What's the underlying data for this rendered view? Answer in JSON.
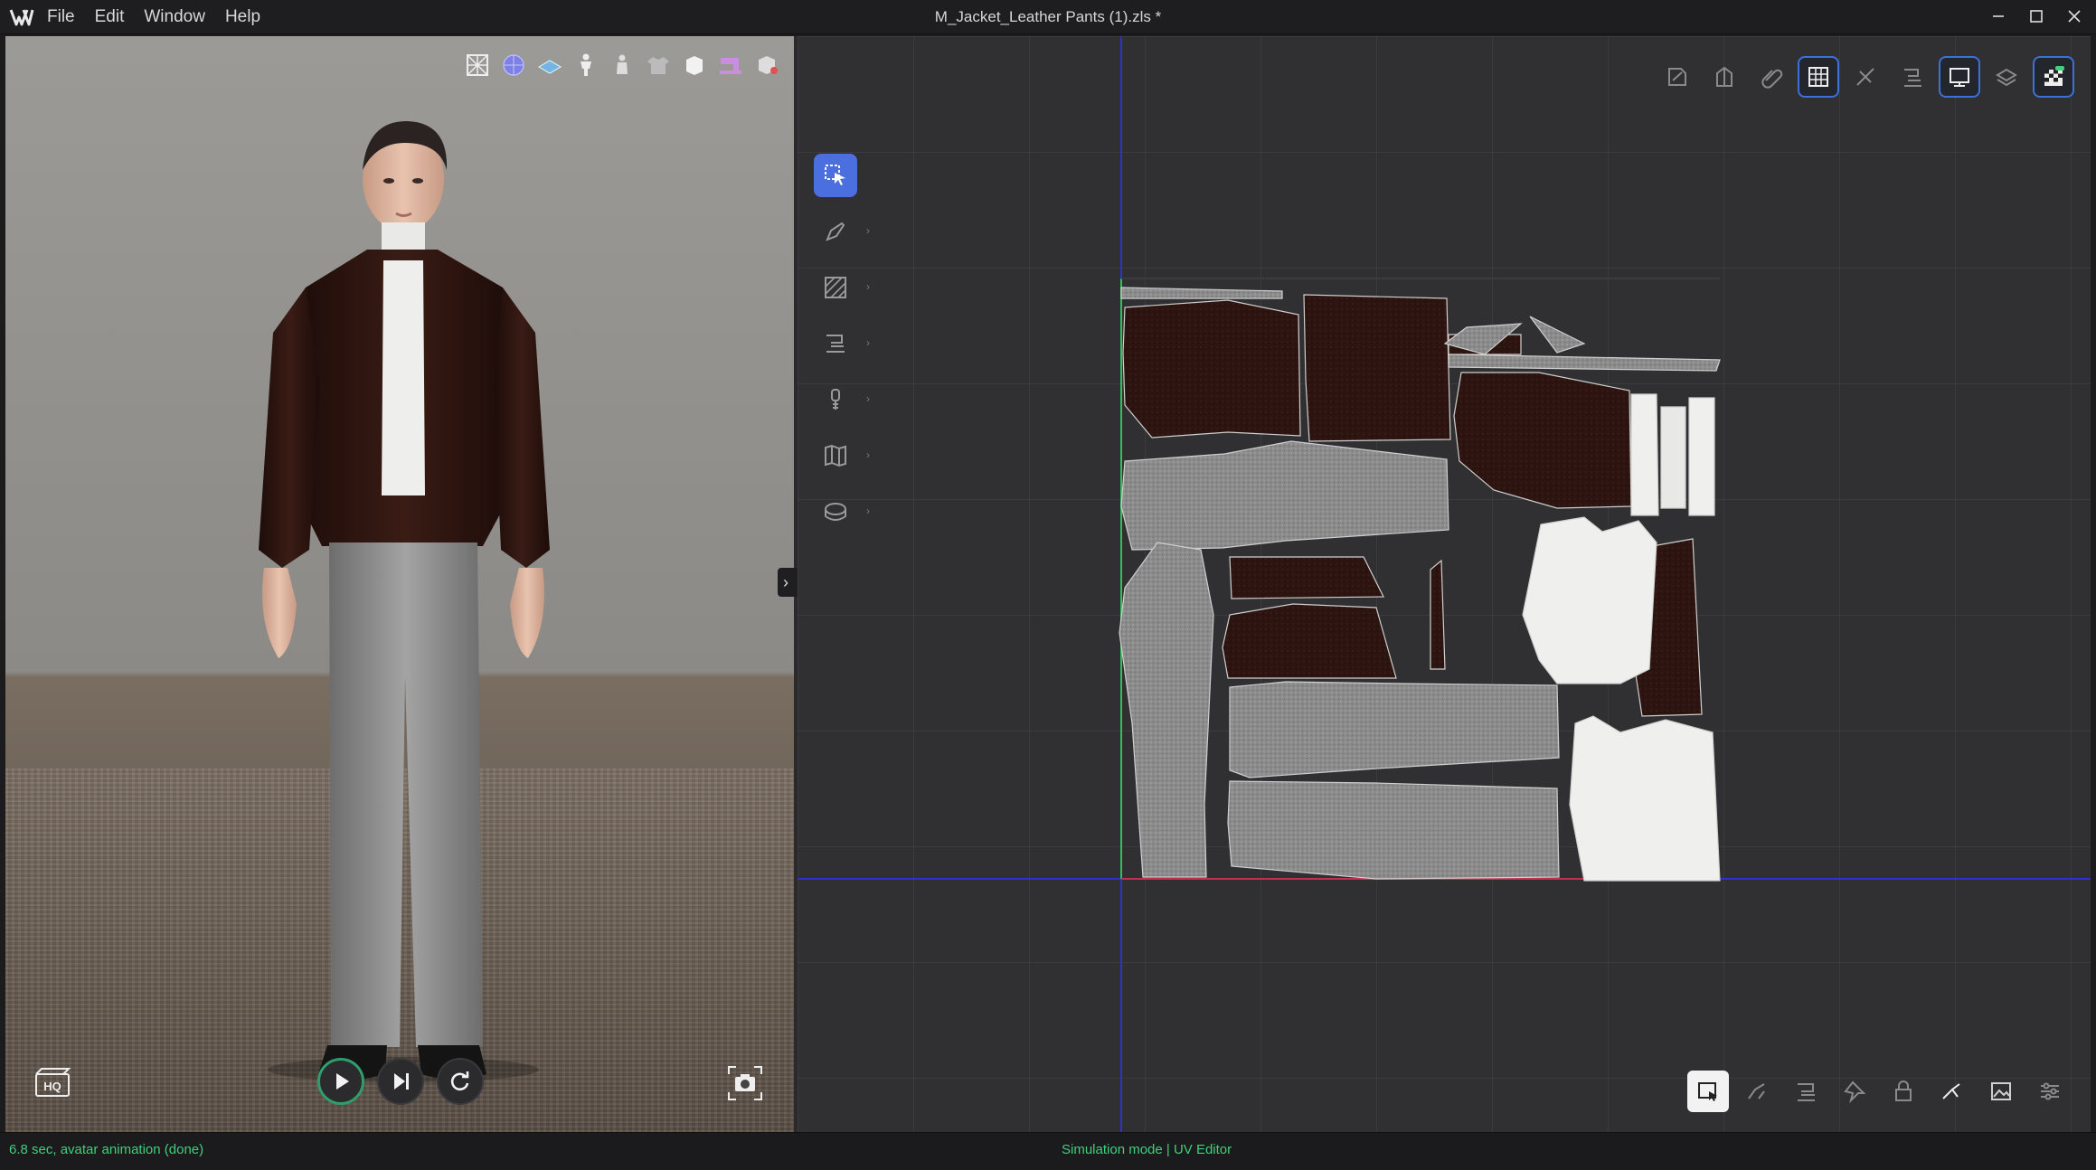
{
  "app": {
    "window_title": "M_Jacket_Leather Pants (1).zls *",
    "menu": [
      "File",
      "Edit",
      "Window",
      "Help"
    ]
  },
  "viewport3d": {
    "toolbar_icons": [
      "pattern-texture-icon",
      "fabric-sphere-icon",
      "floor-plane-icon",
      "avatar-icon",
      "avatar-silhouette-icon",
      "garment-icon",
      "box-icon",
      "sewing-machine-icon",
      "cube-lighting-icon"
    ],
    "playback": {
      "play_icon": "play-icon",
      "step_icon": "step-forward-icon",
      "reset_icon": "reset-icon"
    },
    "hq_label": "HQ"
  },
  "uv_editor": {
    "left_tools": [
      "select-move-tool",
      "pen-tool",
      "texture-hatch-tool",
      "sewing-tool",
      "zipper-tool",
      "fold-map-tool",
      "tape-measure-tool"
    ],
    "top_tools": [
      "uv-layout-icon",
      "uv-shell-icon",
      "attach-icon",
      "grid-toggle-icon",
      "snap-off-icon",
      "seam-icon",
      "preview-icon",
      "layers-icon",
      "checker-icon"
    ],
    "bottom_tools": [
      "select-tool",
      "transform-tool",
      "stack-tool",
      "pin-tool",
      "lock-tool",
      "unfold-tool",
      "image-tool",
      "settings-tool"
    ]
  },
  "status": {
    "left": "6.8 sec, avatar animation (done)",
    "center": "Simulation mode | UV Editor"
  },
  "colors": {
    "accent": "#4c6fe0",
    "status_green": "#3fd07a",
    "leather": "#2c1410",
    "wool_gray": "#8b8b8b",
    "white_fabric": "#efefed"
  }
}
